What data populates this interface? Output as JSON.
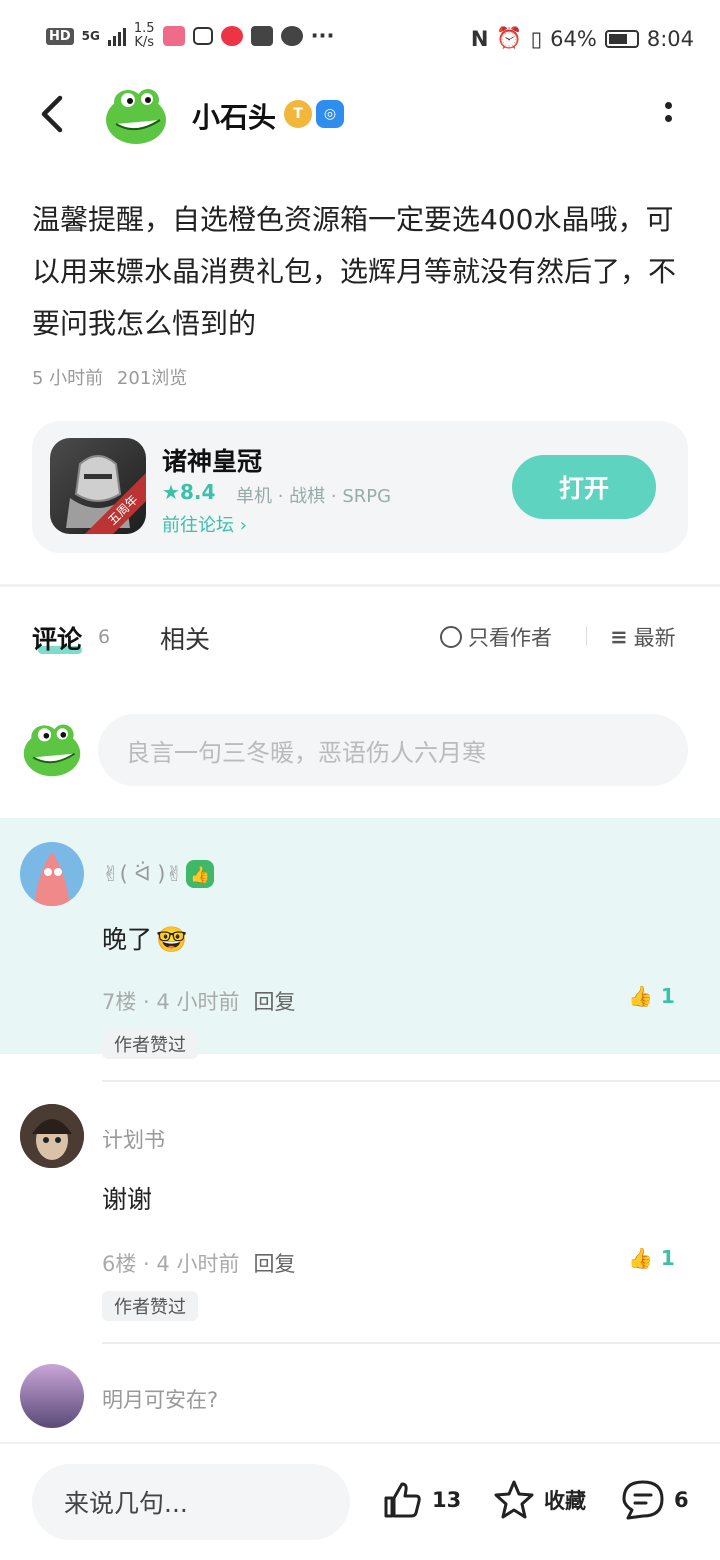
{
  "status": {
    "hd": "HD",
    "net": "5G",
    "speed_top": "1.5",
    "speed_bottom": "K/s",
    "battery": "64%",
    "time": "8:04"
  },
  "header": {
    "username": "小石头",
    "badge_t": "T",
    "badge_game": "◎"
  },
  "post": {
    "text": "温馨提醒，自选橙色资源箱一定要选400水晶哦，可以用来嫖水晶消费礼包，选辉月等就没有然后了，不要问我怎么悟到的",
    "time": "5 小时前",
    "views": "201浏览"
  },
  "game": {
    "ribbon": "五周年",
    "name": "诸神皇冠",
    "rating": "8.4",
    "tags": "单机 · 战棋 · SRPG",
    "forum_link": "前往论坛",
    "open_label": "打开"
  },
  "tabs": {
    "comments_label": "评论",
    "comments_count": "6",
    "related_label": "相关",
    "only_author": "只看作者",
    "sort": "最新"
  },
  "comment_input": {
    "placeholder": "良言一句三冬暖，恶语伤人六月寒"
  },
  "comments": [
    {
      "name": "✌( ᐛ )✌",
      "text": "晚了",
      "floor": "7楼",
      "time": "4 小时前",
      "reply": "回复",
      "likes": "1",
      "author_liked": "作者赞过"
    },
    {
      "name": "计划书",
      "text": "谢谢",
      "floor": "6楼",
      "time": "4 小时前",
      "reply": "回复",
      "likes": "1",
      "author_liked": "作者赞过"
    },
    {
      "name": "明月可安在?"
    }
  ],
  "bottom": {
    "say_placeholder": "来说几句...",
    "like_count": "13",
    "favorite": "收藏",
    "comment_count": "6"
  },
  "colors": {
    "accent": "#5ed3bf",
    "highlight_bg": "#e8f7f6"
  }
}
